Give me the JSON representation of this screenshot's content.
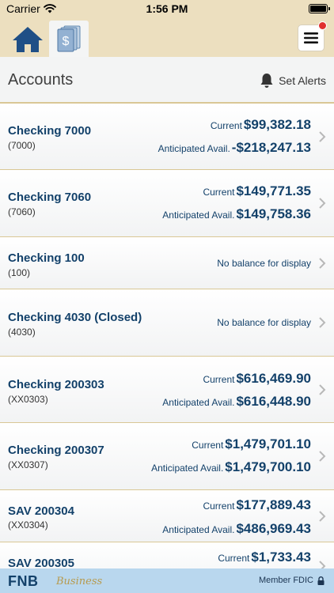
{
  "status": {
    "carrier": "Carrier",
    "time": "1:56 PM"
  },
  "header": {
    "title": "Accounts",
    "set_alerts": "Set Alerts"
  },
  "labels": {
    "current": "Current",
    "anticipated": "Anticipated Avail.",
    "no_balance": "No balance for display"
  },
  "accounts": [
    {
      "name": "Checking 7000",
      "number": "(7000)",
      "current": "$99,382.18",
      "anticipated": "-$218,247.13"
    },
    {
      "name": "Checking 7060",
      "number": "(7060)",
      "current": "$149,771.35",
      "anticipated": "$149,758.36"
    },
    {
      "name": "Checking 100",
      "number": "(100)"
    },
    {
      "name": "Checking 4030 (Closed)",
      "number": "(4030)"
    },
    {
      "name": "Checking 200303",
      "number": "(XX0303)",
      "current": "$616,469.90",
      "anticipated": "$616,448.90"
    },
    {
      "name": "Checking 200307",
      "number": "(XX0307)",
      "current": "$1,479,701.10",
      "anticipated": "$1,479,700.10"
    },
    {
      "name": "SAV 200304",
      "number": "(XX0304)",
      "current": "$177,889.43",
      "anticipated": "$486,969.43"
    },
    {
      "name": "SAV 200305",
      "number": "",
      "current": "$1,733.43",
      "anticipated": ""
    }
  ],
  "footer": {
    "logo": "FNB",
    "logo_sub": "Business",
    "member": "Member FDIC"
  },
  "colors": {
    "tan": "#ecdfbf",
    "navy": "#13416a",
    "divider": "#d9c795",
    "footer_blue": "#b9d7ee",
    "badge_red": "#e0302f"
  }
}
